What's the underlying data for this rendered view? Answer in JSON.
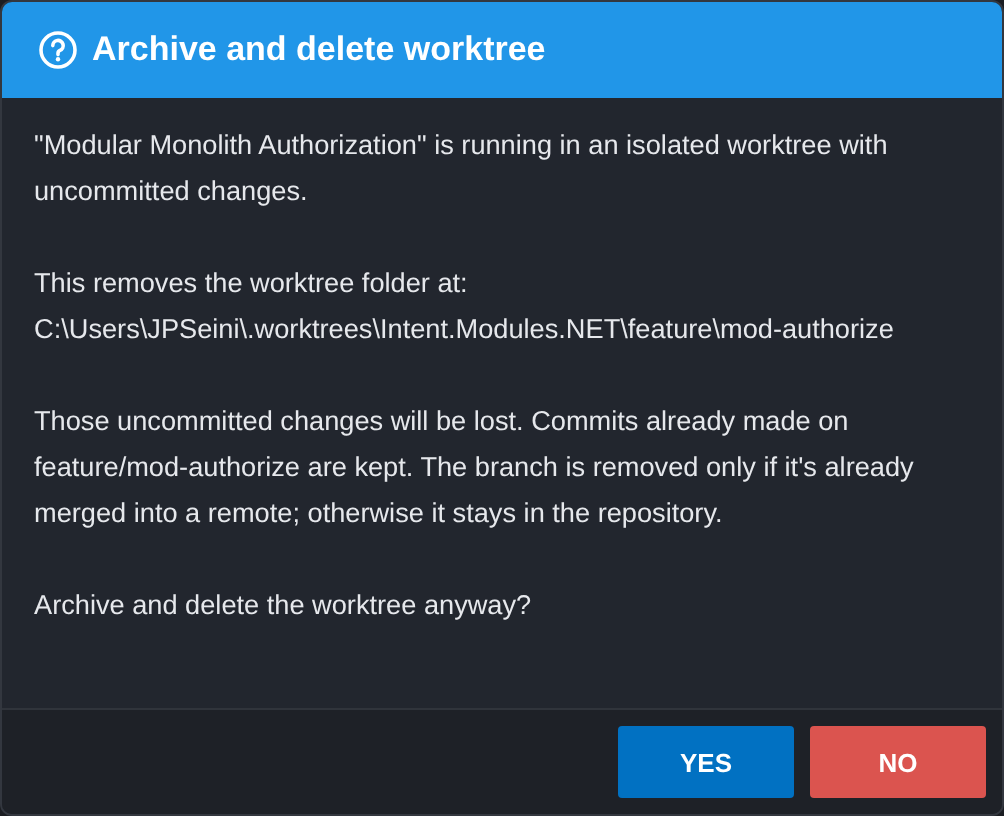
{
  "dialog": {
    "title": "Archive and delete worktree",
    "paragraphs": [
      [
        "\"Modular Monolith Authorization\" is running in an isolated worktree with uncommitted changes."
      ],
      [
        "This removes the worktree folder at:",
        "C:\\Users\\JPSeini\\.worktrees\\Intent.Modules.NET\\feature\\mod-authorize"
      ],
      [
        "Those uncommitted changes will be lost. Commits already made on feature/mod-authorize are kept. The branch is removed only if it's already merged into a remote; otherwise it stays in the repository."
      ],
      [
        "Archive and delete the worktree anyway?"
      ]
    ],
    "buttons": [
      {
        "label": "YES",
        "kind": "primary"
      },
      {
        "label": "NO",
        "kind": "danger"
      }
    ]
  }
}
